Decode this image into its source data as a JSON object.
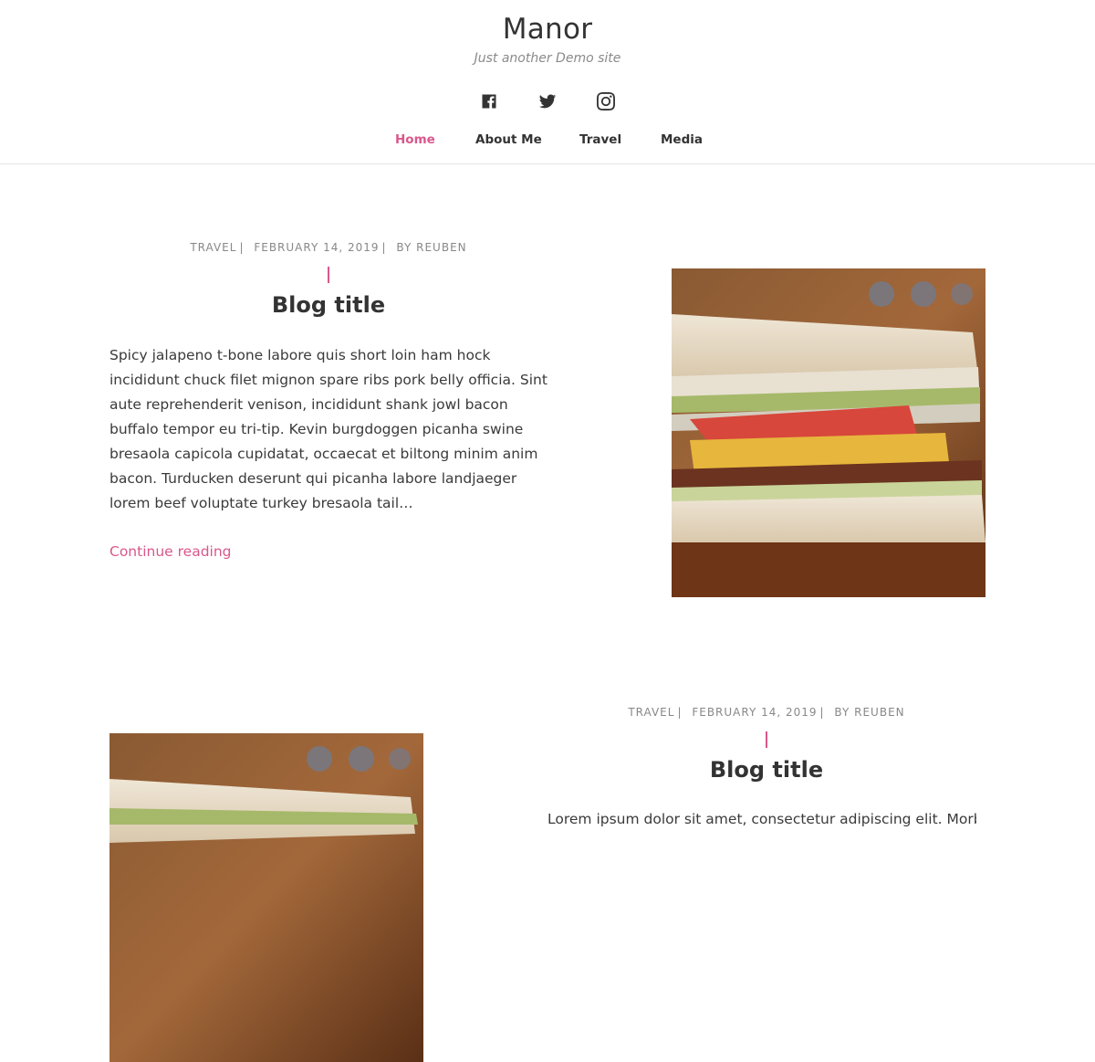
{
  "site": {
    "title": "Manor",
    "tagline": "Just another Demo site"
  },
  "social": [
    {
      "icon": "facebook-icon"
    },
    {
      "icon": "twitter-icon"
    },
    {
      "icon": "instagram-icon"
    }
  ],
  "nav": {
    "items": [
      {
        "label": "Home",
        "active": true
      },
      {
        "label": "About Me",
        "active": false
      },
      {
        "label": "Travel",
        "active": false
      },
      {
        "label": "Media",
        "active": false
      }
    ]
  },
  "colors": {
    "accent": "#d9578c",
    "text": "#333333",
    "meta": "#888888"
  },
  "posts": [
    {
      "category": "TRAVEL",
      "date": "FEBRUARY 14, 2019",
      "by": "BY",
      "author": "REUBEN",
      "title": "Blog title",
      "excerpt": "Spicy jalapeno t-bone labore quis short loin ham hock incididunt chuck filet mignon spare ribs pork belly officia. Sint aute reprehenderit venison, incididunt shank jowl bacon buffalo tempor eu tri-tip. Kevin burgdoggen picanha swine bresaola capicola cupidatat, occaecat et biltong minim anim bacon. Turducken deserunt qui picanha labore landjaeger lorem beef voluptate turkey bresaola tail…",
      "continue": "Continue reading"
    },
    {
      "category": "TRAVEL",
      "date": "FEBRUARY 14, 2019",
      "by": "BY",
      "author": "REUBEN",
      "title": "Blog title",
      "excerpt": "Lorem ipsum dolor sit amet, consectetur adipiscing elit. Morbi"
    }
  ]
}
